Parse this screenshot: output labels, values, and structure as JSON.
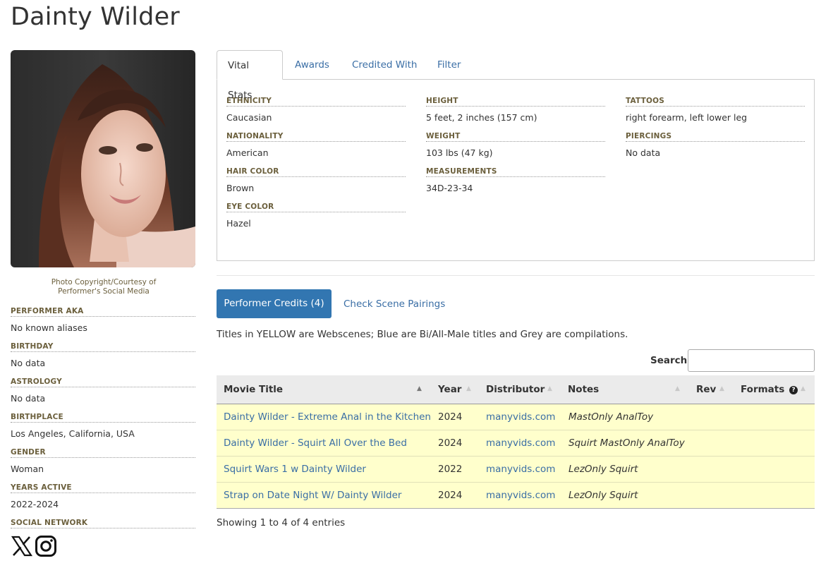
{
  "performer": {
    "name": "Dainty Wilder",
    "photo_caption_line1": "Photo Copyright/Courtesy of",
    "photo_caption_line2": "Performer's Social Media"
  },
  "bio": [
    {
      "label": "PERFORMER AKA",
      "value": "No known aliases"
    },
    {
      "label": "BIRTHDAY",
      "value": "No data"
    },
    {
      "label": "ASTROLOGY",
      "value": "No data"
    },
    {
      "label": "BIRTHPLACE",
      "value": "Los Angeles, California, USA"
    },
    {
      "label": "GENDER",
      "value": "Woman"
    },
    {
      "label": "YEARS ACTIVE",
      "value": "2022-2024"
    }
  ],
  "social": {
    "label": "SOCIAL NETWORK",
    "icons": [
      "x-twitter-icon",
      "instagram-icon"
    ]
  },
  "tabs": [
    {
      "label": "Vital Stats",
      "active": true
    },
    {
      "label": "Awards",
      "active": false
    },
    {
      "label": "Credited With",
      "active": false
    },
    {
      "label": "Filter",
      "active": false
    }
  ],
  "vital_stats": {
    "col1": [
      {
        "label": "ETHNICITY",
        "value": "Caucasian"
      },
      {
        "label": "NATIONALITY",
        "value": "American"
      },
      {
        "label": "HAIR COLOR",
        "value": "Brown"
      },
      {
        "label": "EYE COLOR",
        "value": "Hazel"
      }
    ],
    "col2": [
      {
        "label": "HEIGHT",
        "value": "5 feet, 2 inches (157 cm)"
      },
      {
        "label": "WEIGHT",
        "value": "103 lbs (47 kg)"
      },
      {
        "label": "MEASUREMENTS",
        "value": "34D-23-34"
      }
    ],
    "col3": [
      {
        "label": "TATTOOS",
        "value": "right forearm, left lower leg"
      },
      {
        "label": "PIERCINGS",
        "value": "No data"
      }
    ]
  },
  "credits": {
    "button_label": "Performer Credits (4)",
    "pairings_label": "Check Scene Pairings",
    "legend_note": "Titles in YELLOW are Webscenes; Blue are Bi/All-Male titles and Grey are compilations.",
    "search_label": "Search:",
    "search_value": "",
    "columns": [
      "Movie Title",
      "Year",
      "Distributor",
      "Notes",
      "Rev",
      "Formats"
    ],
    "rows": [
      {
        "title": "Dainty Wilder - Extreme Anal in the Kitchen",
        "year": "2024",
        "distributor": "manyvids.com",
        "notes": "MastOnly AnalToy",
        "rev": "",
        "formats": ""
      },
      {
        "title": "Dainty Wilder - Squirt All Over the Bed",
        "year": "2024",
        "distributor": "manyvids.com",
        "notes": "Squirt MastOnly AnalToy",
        "rev": "",
        "formats": ""
      },
      {
        "title": "Squirt Wars 1 w Dainty Wilder",
        "year": "2022",
        "distributor": "manyvids.com",
        "notes": "LezOnly Squirt",
        "rev": "",
        "formats": ""
      },
      {
        "title": "Strap on Date Night W/ Dainty Wilder",
        "year": "2024",
        "distributor": "manyvids.com",
        "notes": "LezOnly Squirt",
        "rev": "",
        "formats": ""
      }
    ],
    "showing": "Showing 1 to 4 of 4 entries"
  },
  "colors": {
    "link": "#3a6ea5",
    "button": "#3276b1",
    "webscene_row": "#ffffcc",
    "label": "#6b5f3c"
  }
}
